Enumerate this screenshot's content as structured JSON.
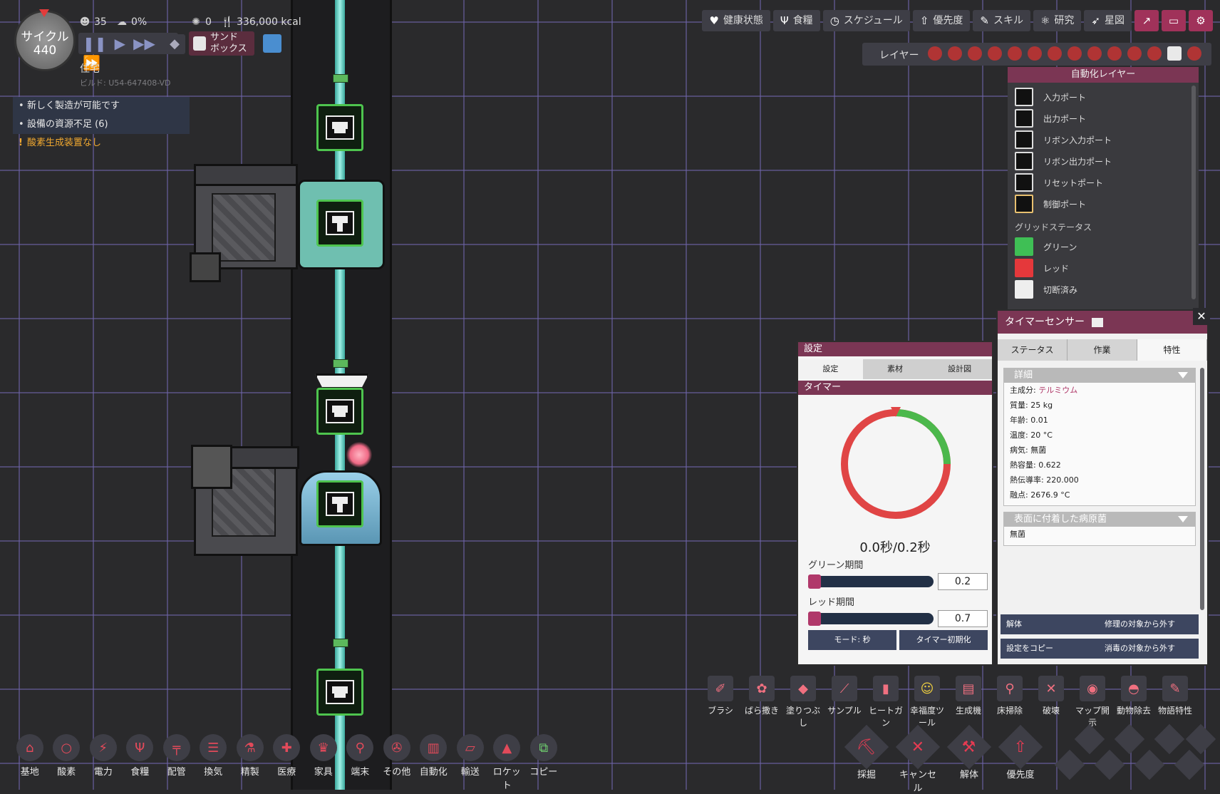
{
  "hud": {
    "cycle_label": "サイクル",
    "cycle_number": "440",
    "duplicants": "35",
    "stress": "0%",
    "sick": "0",
    "food": "336,000 kcal",
    "sandbox_label": "サンド\nボックス",
    "room_type": "住宅",
    "build_id": "ビルド: U54-647408-VD"
  },
  "alerts": [
    {
      "text": "新しく製造が可能です",
      "type": "info"
    },
    {
      "text": "設備の資源不足 (6)",
      "type": "info"
    },
    {
      "text": "酸素生成装置なし",
      "type": "warning"
    }
  ],
  "topbar": [
    "健康状態",
    "食糧",
    "スケジュール",
    "優先度",
    "スキル",
    "研究",
    "星図"
  ],
  "layer_label": "レイヤー",
  "legend": {
    "title": "自動化レイヤー",
    "ports": [
      "入力ポート",
      "出力ポート",
      "リボン入力ポート",
      "リボン出力ポート",
      "リセットポート",
      "制御ポート"
    ],
    "grid_status_label": "グリッドステータス",
    "statuses": [
      "グリーン",
      "レッド",
      "切断済み"
    ]
  },
  "side_panel": {
    "title": "タイマーセンサー",
    "tabs": [
      "ステータス",
      "作業",
      "特性"
    ],
    "details_header": "詳細",
    "details": [
      {
        "label": "主成分: ",
        "value": "テルミウム"
      },
      {
        "label": "質量: 25 kg",
        "value": ""
      },
      {
        "label": "年齢: 0.01",
        "value": ""
      },
      {
        "label": "温度: 20 °C",
        "value": ""
      },
      {
        "label": "病気: 無菌",
        "value": ""
      },
      {
        "label": "熱容量: 0.622",
        "value": ""
      },
      {
        "label": "熱伝導率: 220.000",
        "value": ""
      },
      {
        "label": "融点: 2676.9 °C",
        "value": ""
      }
    ],
    "germs_header": "表面に付着した病原菌",
    "germs_value": "無菌",
    "buttons": [
      "解体",
      "修理の対象から外す",
      "設定をコピー",
      "消毒の対象から外す"
    ]
  },
  "settings": {
    "title": "設定",
    "tabs": [
      "設定",
      "素材",
      "設計図"
    ],
    "section": "タイマー",
    "ratio": "0.0秒/0.2秒",
    "green_label": "グリーン期間",
    "green_value": "0.2",
    "red_label": "レッド期間",
    "red_value": "0.7",
    "mode_button": "モード: 秒",
    "reset_button": "タイマー初期化"
  },
  "tools": [
    "ブラシ",
    "ばら撒き",
    "塗りつぶし",
    "サンプル",
    "ヒートガン",
    "幸福度ツール",
    "生成機",
    "床掃除",
    "破壊",
    "マップ開示",
    "動物除去",
    "物語特性"
  ],
  "big_tools": [
    "採掘",
    "キャンセル",
    "解体",
    "優先度"
  ],
  "build_menu": [
    "基地",
    "酸素",
    "電力",
    "食糧",
    "配管",
    "換気",
    "精製",
    "医療",
    "家具",
    "端末",
    "その他",
    "自動化",
    "輸送",
    "ロケット",
    "コピー"
  ],
  "colors": {
    "accent": "#7b3654",
    "green": "#3fbf55",
    "red": "#e5383b",
    "wire": "#9ff0e6"
  }
}
